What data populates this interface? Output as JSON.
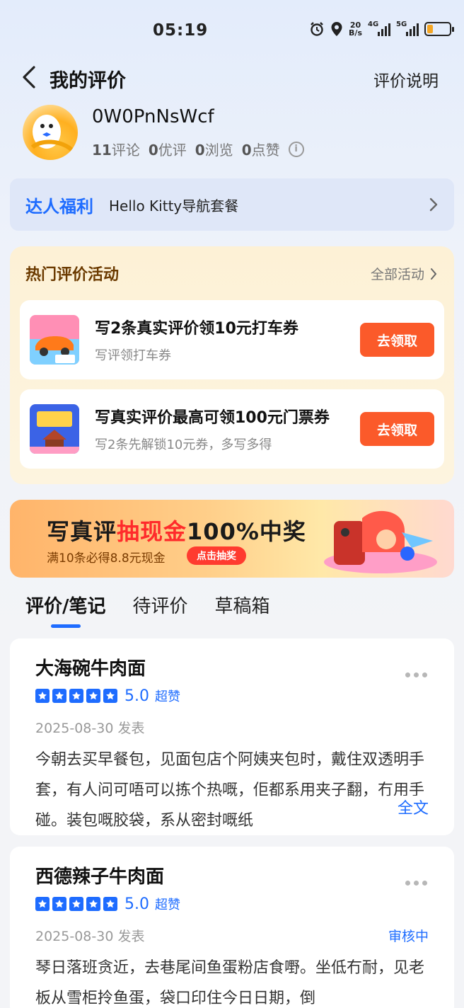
{
  "status_bar": {
    "time": "05:19",
    "net_speed_top": "20",
    "net_speed_bottom": "B/s",
    "sim1": "4G",
    "sim2": "5G",
    "battery_level": 0.25
  },
  "header": {
    "title": "我的评价",
    "explain_label": "评价说明"
  },
  "profile": {
    "username": "0W0PnNsWcf",
    "stats": [
      {
        "num": "11",
        "label": "评论"
      },
      {
        "num": "0",
        "label": "优评"
      },
      {
        "num": "0",
        "label": "浏览"
      },
      {
        "num": "0",
        "label": "点赞"
      }
    ]
  },
  "expert": {
    "label": "达人福利",
    "value": "Hello Kitty导航套餐"
  },
  "hot_activities": {
    "title": "热门评价活动",
    "all_label": "全部活动",
    "items": [
      {
        "title": "写2条真实评价领10元打车券",
        "subtitle": "写评领打车券",
        "button": "去领取"
      },
      {
        "title": "写真实评价最高可领100元门票券",
        "subtitle": "写2条先解锁10元券，多写多得",
        "button": "去领取"
      }
    ]
  },
  "banner": {
    "line1_a": "写真评",
    "line1_b": "抽现金",
    "line1_c": "100%中奖",
    "line2": "满10条必得8.8元现金",
    "pill": "点击抽奖"
  },
  "tabs": [
    "评价/笔记",
    "待评价",
    "草稿箱"
  ],
  "reviews": [
    {
      "shop": "大海碗牛肉面",
      "score": "5.0",
      "tag": "超赞",
      "date": "2025-08-30 发表",
      "status": "",
      "text": "今朝去买早餐包，见面包店个阿姨夹包时，戴住双透明手套，有人问可唔可以拣个热嘅，佢都系用夹子翻，冇用手碰。装包嘅胶袋，系从密封嘅纸",
      "full_label": "全文"
    },
    {
      "shop": "西德辣子牛肉面",
      "score": "5.0",
      "tag": "超赞",
      "date": "2025-08-30 发表",
      "status": "审核中",
      "text": "琴日落班贪近，去巷尾间鱼蛋粉店食嘢。坐低冇耐，见老板从雪柜拎鱼蛋，袋口印住今日日期，倒",
      "full_label": ""
    }
  ]
}
